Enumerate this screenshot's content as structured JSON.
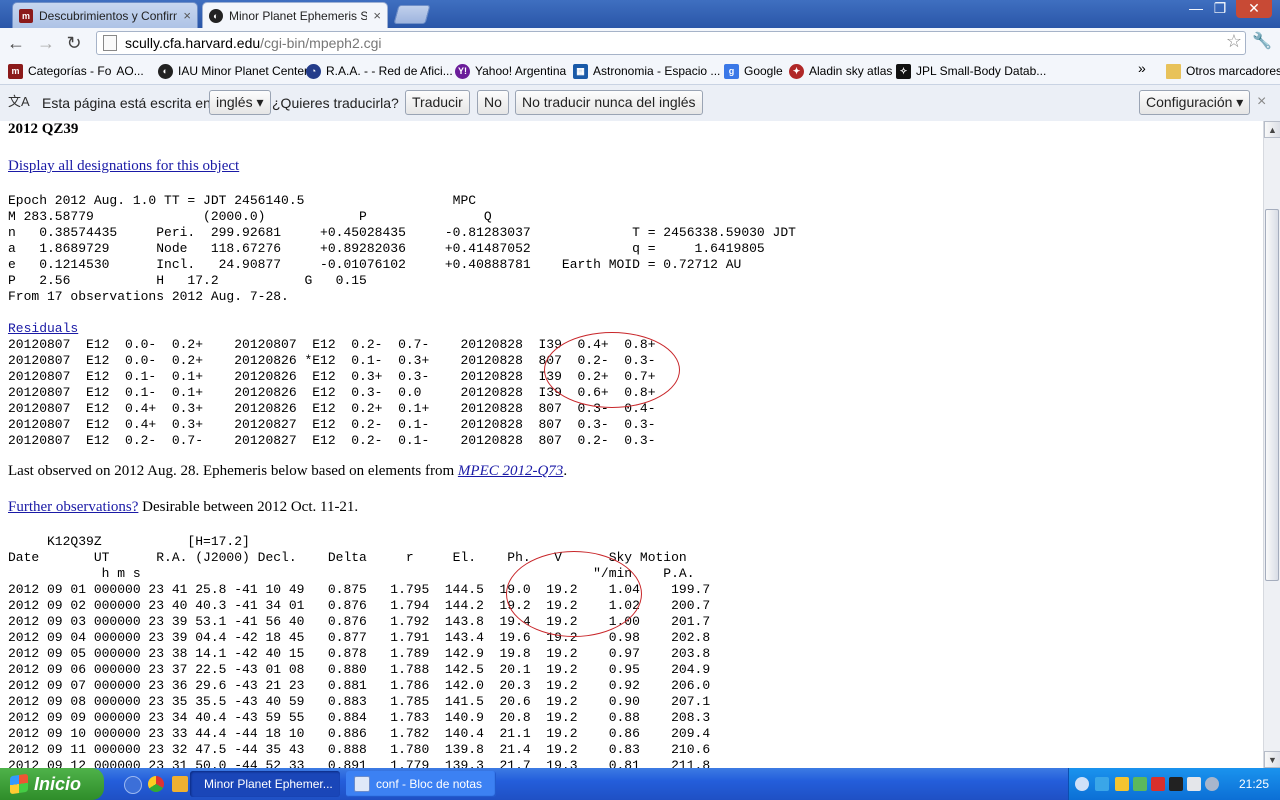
{
  "tabs": [
    {
      "title": "Descubrimientos y Confirmaci",
      "close": "×",
      "favicon": "m-favicon"
    },
    {
      "title": "Minor Planet Ephemeris Servic",
      "close": "×",
      "favicon": "planet-favicon"
    }
  ],
  "window_controls": {
    "minimize": "—",
    "maximize": "❐",
    "close": "✕"
  },
  "toolbar": {
    "back": "←",
    "forward": "→",
    "reload": "↻",
    "url_host": "scully.cfa.harvard.edu",
    "url_path": "/cgi-bin/mpeph2.cgi",
    "star": "☆",
    "wrench": "🔧"
  },
  "bookmarks": {
    "items": [
      {
        "label": "Categorías - Fo",
        "extra": "AO...",
        "icon": "m-icon",
        "color": "#8b1a1a"
      },
      {
        "label": "IAU Minor Planet Center",
        "icon": "planet-icon",
        "color": "#222"
      },
      {
        "label": "R.A.A. - - Red de Afici...",
        "icon": "globe-icon",
        "color": "#243c8a"
      },
      {
        "label": "Yahoo! Argentina",
        "icon": "yahoo-icon",
        "color": "#6b1d9a"
      },
      {
        "label": "Astronomia - Espacio ...",
        "icon": "space-icon",
        "color": "#1a5aa8"
      },
      {
        "label": "Google",
        "icon": "google-icon",
        "color": "#3b78e7"
      },
      {
        "label": "Aladin sky atlas",
        "icon": "aladin-icon",
        "color": "#b02828"
      },
      {
        "label": "JPL Small-Body Datab...",
        "icon": "jpl-icon",
        "color": "#111"
      }
    ],
    "more": "»",
    "other": "Otros marcadores"
  },
  "translate_bar": {
    "text1": "Esta página está escrita en",
    "language": "inglés",
    "question": "¿Quieres traducirla?",
    "translate_btn": "Traducir",
    "no_btn": "No",
    "never_btn": "No traducir nunca del inglés",
    "config_btn": "Configuración",
    "close": "×"
  },
  "page": {
    "title": "2012 QZ39",
    "designations_link": "Display all designations for this object",
    "orbit_elements": "Epoch 2012 Aug. 1.0 TT = JDT 2456140.5                   MPC\nM 283.58779              (2000.0)            P               Q\nn   0.38574435     Peri.  299.92681     +0.45028435     -0.81283037             T = 2456338.59030 JDT\na   1.8689729      Node   118.67276     +0.89282036     +0.41487052             q =     1.6419805\ne   0.1214530      Incl.   24.90877     -0.01076102     +0.40888781    Earth MOID = 0.72712 AU\nP   2.56           H   17.2           G   0.15\nFrom 17 observations 2012 Aug. 7-28.",
    "residuals_label": "Residuals",
    "residuals": "20120807  E12  0.0-  0.2+    20120807  E12  0.2-  0.7-    20120828  I39  0.4+  0.8+\n20120807  E12  0.0-  0.2+    20120826 *E12  0.1-  0.3+    20120828  807  0.2-  0.3-\n20120807  E12  0.1-  0.1+    20120826  E12  0.3+  0.3-    20120828  I39  0.2+  0.7+\n20120807  E12  0.1-  0.1+    20120826  E12  0.3-  0.0     20120828  I39  0.6+  0.8+\n20120807  E12  0.4+  0.3+    20120826  E12  0.2+  0.1+    20120828  807  0.3-  0.4-\n20120807  E12  0.4+  0.3+    20120827  E12  0.2-  0.1-    20120828  807  0.3-  0.3-\n20120807  E12  0.2-  0.7-    20120827  E12  0.2-  0.1-    20120828  807  0.2-  0.3-",
    "last_observed_text": "Last observed on 2012 Aug. 28. Ephemeris below based on elements from ",
    "mpec_link": "MPEC 2012-Q73",
    "mpec_after": ".",
    "further_link": "Further observations?",
    "further_text": " Desirable between 2012 Oct. 11-21.",
    "ephemeris_header": "     K12Q39Z           [H=17.2]\nDate       UT      R.A. (J2000) Decl.    Delta     r     El.    Ph.   V      Sky Motion\n            h m s                                                          \"/min    P.A.",
    "ephemeris_rows": "2012 09 01 000000 23 41 25.8 -41 10 49   0.875   1.795  144.5  19.0  19.2    1.04    199.7\n2012 09 02 000000 23 40 40.3 -41 34 01   0.876   1.794  144.2  19.2  19.2    1.02    200.7\n2012 09 03 000000 23 39 53.1 -41 56 40   0.876   1.792  143.8  19.4  19.2    1.00    201.7\n2012 09 04 000000 23 39 04.4 -42 18 45   0.877   1.791  143.4  19.6  19.2    0.98    202.8\n2012 09 05 000000 23 38 14.1 -42 40 15   0.878   1.789  142.9  19.8  19.2    0.97    203.8\n2012 09 06 000000 23 37 22.5 -43 01 08   0.880   1.788  142.5  20.1  19.2    0.95    204.9\n2012 09 07 000000 23 36 29.6 -43 21 23   0.881   1.786  142.0  20.3  19.2    0.92    206.0\n2012 09 08 000000 23 35 35.5 -43 40 59   0.883   1.785  141.5  20.6  19.2    0.90    207.1\n2012 09 09 000000 23 34 40.4 -43 59 55   0.884   1.783  140.9  20.8  19.2    0.88    208.3\n2012 09 10 000000 23 33 44.4 -44 18 10   0.886   1.782  140.4  21.1  19.2    0.86    209.4\n2012 09 11 000000 23 32 47.5 -44 35 43   0.888   1.780  139.8  21.4  19.2    0.83    210.6\n2012 09 12 000000 23 31 50.0 -44 52 33   0.891   1.779  139.3  21.7  19.3    0.81    211.8"
  },
  "scrollbar": {
    "up": "▲",
    "down": "▼"
  },
  "taskbar": {
    "start": "Inicio",
    "tasks": [
      {
        "label": "Minor Planet Ephemer...",
        "icon": "chrome-icon"
      },
      {
        "label": "conf - Bloc de notas",
        "icon": "notepad-icon"
      }
    ],
    "clock": "21:25"
  },
  "colors": {
    "annotation": "#c8262a",
    "link": "#1a1aa6"
  }
}
